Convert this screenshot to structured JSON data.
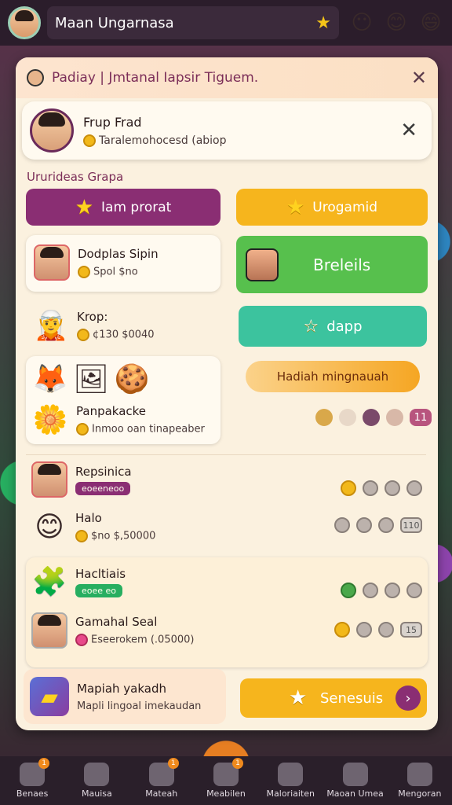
{
  "topbar": {
    "user_name": "Maan Ungarnasa"
  },
  "panel": {
    "title": "Padiay | Jmtanal Iapsir Tiguem.",
    "profile": {
      "name": "Frup Frad",
      "subtitle": "Taralemohocesd (abiop"
    },
    "section_label": "Ururideas Grapa",
    "buttons": {
      "purple": "Iam prorat",
      "orange": "Urogamid",
      "green": "Breleils",
      "teal": "dapp",
      "hadiah": "Hadiah mingnauah",
      "send": "Senesuis"
    },
    "counter_value": "11",
    "left_items": [
      {
        "name": "Dodplas Sipin",
        "sub": "Spol $no"
      },
      {
        "name": "Krop:",
        "sub": "¢130  $0040"
      },
      {
        "name": "Panpakacke",
        "sub": "Inmoo oan tinapeaber"
      }
    ],
    "rows": [
      {
        "name": "Repsinica",
        "pill": "eoeeneoo",
        "end": ""
      },
      {
        "name": "Halo",
        "sub": "$no   $,50000",
        "end": "110"
      },
      {
        "name": "Hacltiais",
        "pill": "eoee eo",
        "end": ""
      },
      {
        "name": "Gamahal Seal",
        "sub": "Eseerokem (.05000)",
        "end": "15"
      }
    ],
    "bottom": {
      "name": "Mapiah yakadh",
      "sub": "Mapli lingoal imekaudan"
    }
  },
  "nav": {
    "items": [
      {
        "label": "Benaes",
        "badge": "1"
      },
      {
        "label": "Mauisa",
        "badge": ""
      },
      {
        "label": "Mateah",
        "badge": "1"
      },
      {
        "label": "Meabilen",
        "badge": "1"
      },
      {
        "label": "Maloriaiten",
        "badge": ""
      },
      {
        "label": "Maoan Umea",
        "badge": ""
      },
      {
        "label": "Mengoran",
        "badge": ""
      }
    ]
  }
}
